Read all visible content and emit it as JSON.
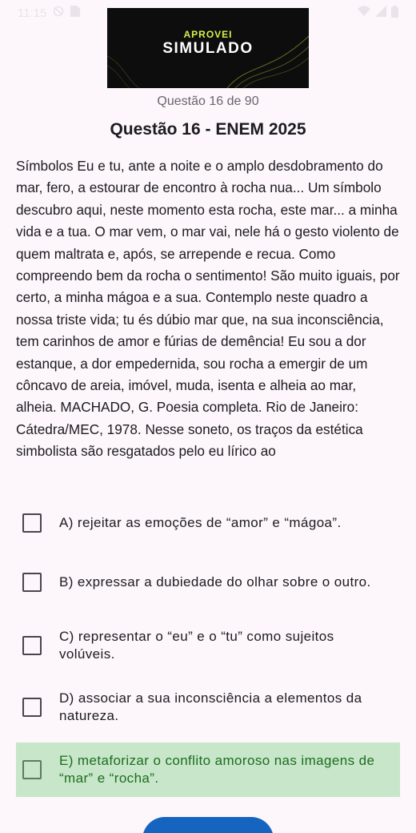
{
  "status_bar": {
    "time": "11:15"
  },
  "banner": {
    "top_text": "APROVEI",
    "main_text": "SIMULADO"
  },
  "question": {
    "counter": "Questão 16 de 90",
    "title": "Questão 16 - ENEM 2025",
    "statement": "Símbolos Eu e tu, ante a noite e o amplo desdobramento do mar, fero, a estourar de encontro à rocha nua... Um símbolo descubro aqui, neste momento esta rocha, este mar... a minha vida e a tua. O mar vem, o mar vai, nele há o gesto violento de quem maltrata e, após, se arrepende e recua. Como compreendo bem da rocha o sentimento! São muito iguais, por certo, a minha mágoa e a sua. Contemplo neste quadro a nossa triste vida; tu és dúbio mar que, na sua inconsciência, tem carinhos de amor e fúrias de demência! Eu sou a dor estanque, a dor empedernida, sou rocha a emergir de um côncavo de areia, imóvel, muda, isenta e alheia ao mar, alheia. MACHADO, G. Poesia completa. Rio de Janeiro: Cátedra/MEC, 1978. Nesse soneto, os traços da estética simbolista são resgatados pelo eu lírico ao"
  },
  "options": [
    {
      "text": "A) rejeitar as emoções de “amor” e “mágoa”.",
      "selected": false
    },
    {
      "text": "B) expressar a dubiedade do olhar sobre o outro.",
      "selected": false
    },
    {
      "text": "C) representar o “eu” e o “tu” como sujeitos volúveis.",
      "selected": false
    },
    {
      "text": "D) associar a sua inconsciência a elementos da natureza.",
      "selected": false
    },
    {
      "text": "E) metaforizar o conflito amoroso nas imagens de “mar” e “rocha”.",
      "selected": true
    }
  ],
  "colors": {
    "background": "#fdf6fb",
    "selected_background": "#c8e6c9",
    "selected_text": "#1b6e1f",
    "fab": "#1565c0",
    "banner_accent": "#d6f04a"
  },
  "icons": {
    "status_left": [
      "do-not-disturb-icon",
      "sim-card-icon"
    ],
    "status_right": [
      "wifi-icon",
      "signal-icon",
      "battery-icon"
    ]
  }
}
